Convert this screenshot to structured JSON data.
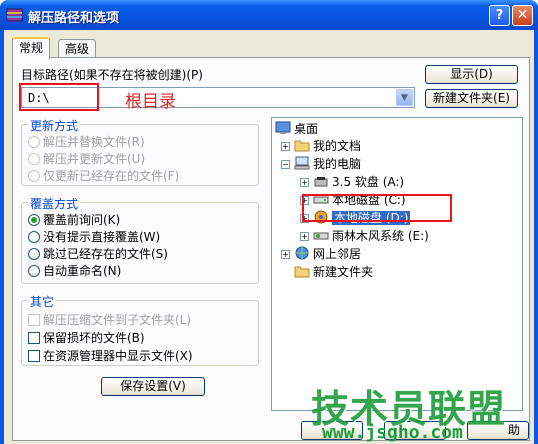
{
  "window": {
    "title": "解压路径和选项",
    "help_label": "?",
    "close_label": "✕"
  },
  "tabs": [
    {
      "label": "常规"
    },
    {
      "label": "高级"
    }
  ],
  "target": {
    "label": "目标路径(如果不存在将被创建)(P)",
    "value": "D:\\",
    "show_button": "显示(D)",
    "new_folder_button": "新建文件夹(E)"
  },
  "annotation": "根目录",
  "update_mode": {
    "title": "更新方式",
    "options": [
      {
        "label": "解压并替换文件(R)"
      },
      {
        "label": "解压并更新文件(U)"
      },
      {
        "label": "仅更新已经存在的文件(F)"
      }
    ]
  },
  "overwrite_mode": {
    "title": "覆盖方式",
    "options": [
      {
        "label": "覆盖前询问(K)",
        "selected": true
      },
      {
        "label": "没有提示直接覆盖(W)"
      },
      {
        "label": "跳过已经存在的文件(S)"
      },
      {
        "label": "自动重命名(N)"
      }
    ]
  },
  "misc": {
    "title": "其它",
    "options": [
      {
        "label": "解压压缩文件到子文件夹(L)",
        "disabled": true
      },
      {
        "label": "保留损坏的文件(B)"
      },
      {
        "label": "在资源管理器中显示文件(X)"
      }
    ]
  },
  "save_button": "保存设置(V)",
  "tree": {
    "items": [
      {
        "label": "桌面",
        "icon": "desktop-icon"
      },
      {
        "label": "我的文档",
        "icon": "folder-icon"
      },
      {
        "label": "我的电脑",
        "icon": "computer-icon"
      },
      {
        "label": "3.5 软盘 (A:)",
        "icon": "floppy-icon"
      },
      {
        "label": "本地磁盘 (C:)",
        "icon": "drive-icon"
      },
      {
        "label": "本地磁盘 (D:)",
        "icon": "drive-icon",
        "selected": true
      },
      {
        "label": "雨林木风系统 (E:)",
        "icon": "drive-icon"
      },
      {
        "label": "网上邻居",
        "icon": "network-icon"
      },
      {
        "label": "新建文件夹",
        "icon": "folder-icon"
      }
    ]
  },
  "bottom_partial_button": "助",
  "watermark": {
    "text": "技术员联盟",
    "url": "www.jsgho.com"
  },
  "colors": {
    "title_bar": "#0a5fe8",
    "accent_red": "#e8141e",
    "selection": "#316ac5",
    "watermark": "#1e9c3a"
  }
}
